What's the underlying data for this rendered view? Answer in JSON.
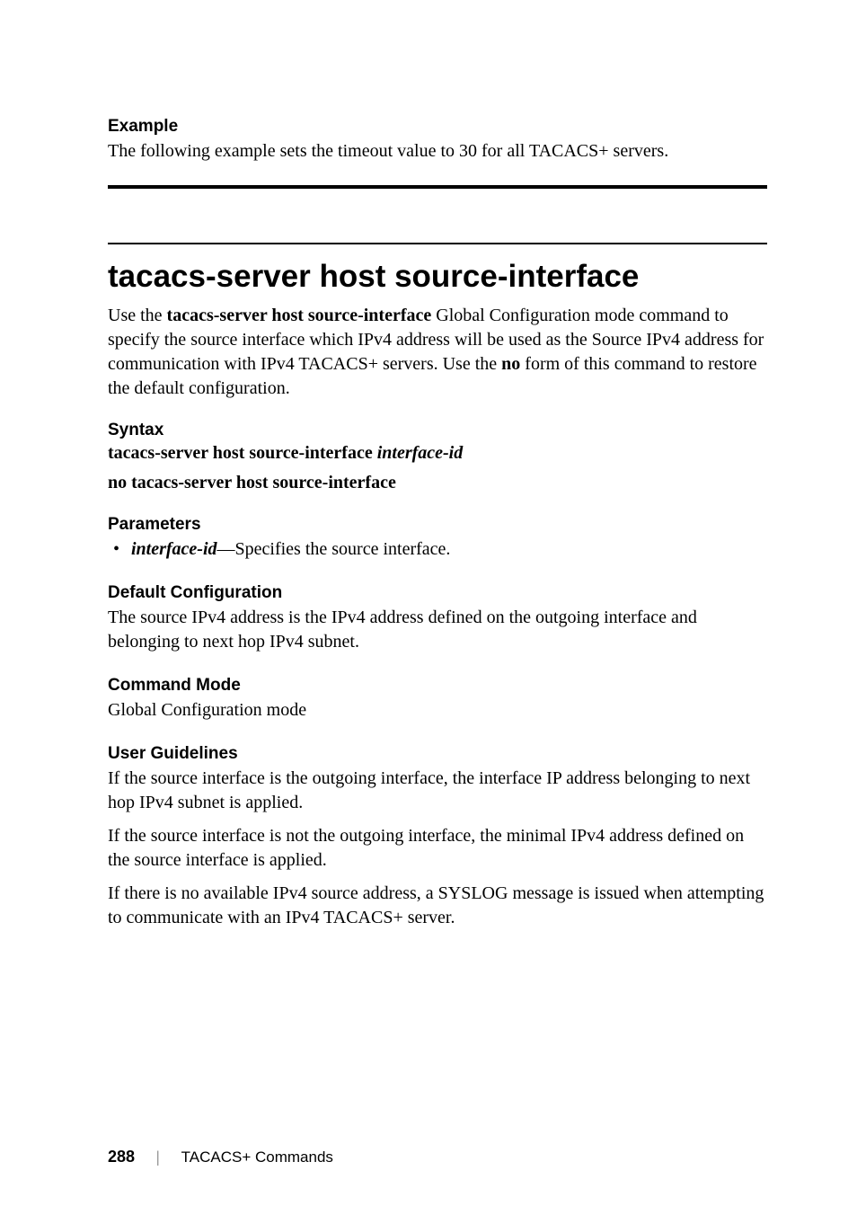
{
  "example": {
    "heading": "Example",
    "text": "The following example sets the timeout value to 30 for all TACACS+ servers."
  },
  "command": {
    "title": "tacacs-server host source-interface",
    "intro_part1": "Use the ",
    "intro_bold1": "tacacs-server host source-interface",
    "intro_part2": " Global Configuration mode command to specify the source interface which IPv4 address will be used as the Source IPv4 address for communication with IPv4 TACACS+ servers. Use the ",
    "intro_bold2": "no",
    "intro_part3": " form of this command to restore the default configuration."
  },
  "syntax": {
    "heading": "Syntax",
    "line1_bold": "tacacs-server host source-interface ",
    "line1_italic": "interface-id",
    "line2": "no tacacs-server host source-interface"
  },
  "parameters": {
    "heading": "Parameters",
    "item1_italic": "interface-id",
    "item1_text": "—Specifies the source interface."
  },
  "default_config": {
    "heading": "Default Configuration",
    "text": "The source IPv4 address is the IPv4 address defined on the outgoing interface and belonging to next hop IPv4 subnet."
  },
  "command_mode": {
    "heading": "Command Mode",
    "text": "Global Configuration mode"
  },
  "user_guidelines": {
    "heading": "User Guidelines",
    "para1": "If the source interface is the outgoing interface, the interface IP address belonging to next hop IPv4 subnet is applied.",
    "para2": "If the source interface is not the outgoing interface, the minimal IPv4 address defined on the source interface is applied.",
    "para3": "If there is no available IPv4 source address, a SYSLOG message is issued when attempting to communicate with an IPv4 TACACS+ server."
  },
  "footer": {
    "page": "288",
    "sep": "|",
    "title": "TACACS+ Commands"
  }
}
